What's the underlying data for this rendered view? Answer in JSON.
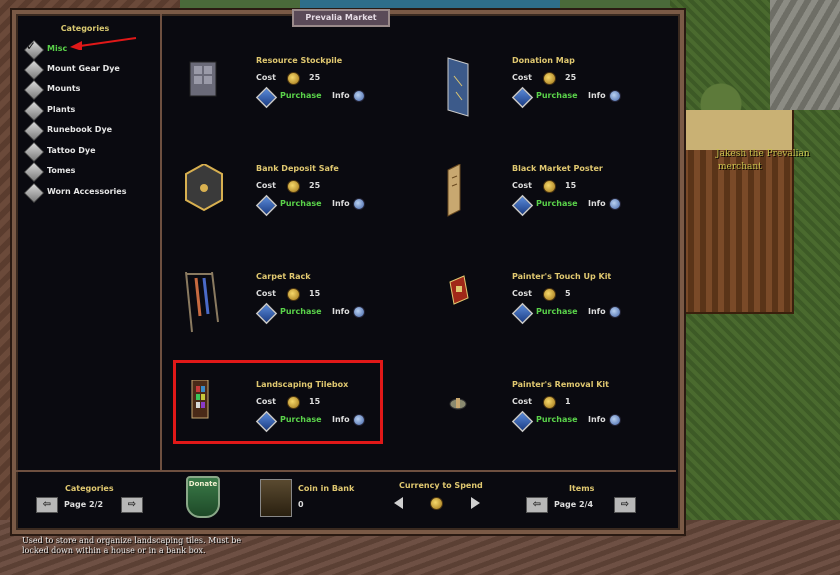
{
  "window": {
    "title": "Prevalia Market"
  },
  "merchant": {
    "line1": "Jakesh the Prevalian",
    "line2": "merchant"
  },
  "sidebar": {
    "header": "Categories",
    "items": [
      {
        "label": "Misc",
        "selected": true
      },
      {
        "label": "Mount Gear Dye"
      },
      {
        "label": "Mounts"
      },
      {
        "label": "Plants"
      },
      {
        "label": "Runebook Dye"
      },
      {
        "label": "Tattoo Dye"
      },
      {
        "label": "Tomes"
      },
      {
        "label": "Worn Accessories"
      }
    ]
  },
  "labels": {
    "cost": "Cost",
    "purchase": "Purchase",
    "info": "Info"
  },
  "items": [
    {
      "name": "Resource Stockpile",
      "cost": "25",
      "icon": "stockpile-icon"
    },
    {
      "name": "Donation Map",
      "cost": "25",
      "icon": "map-icon"
    },
    {
      "name": "Bank Deposit Safe",
      "cost": "25",
      "icon": "safe-icon"
    },
    {
      "name": "Black Market Poster",
      "cost": "15",
      "icon": "poster-icon"
    },
    {
      "name": "Carpet Rack",
      "cost": "15",
      "icon": "carpet-rack-icon"
    },
    {
      "name": "Painter's Touch Up Kit",
      "cost": "5",
      "icon": "paint-kit-icon"
    },
    {
      "name": "Landscaping Tilebox",
      "cost": "15",
      "icon": "tilebox-icon"
    },
    {
      "name": "Painter's Removal Kit",
      "cost": "1",
      "icon": "removal-kit-icon"
    }
  ],
  "footer": {
    "categories_label": "Categories",
    "categories_page": "Page  2/2",
    "donate_label": "Donate",
    "coin_label": "Coin in Bank",
    "coin_value": "0",
    "currency_label": "Currency to Spend",
    "items_label": "Items",
    "items_page": "Page  2/4"
  },
  "description": "Used to store and organize landscaping tiles. Must be locked down within a house or in a bank box.",
  "colors": {
    "accent_gold": "#e0c870",
    "selected_green": "#5ad24a",
    "highlight_red": "#e01818"
  }
}
